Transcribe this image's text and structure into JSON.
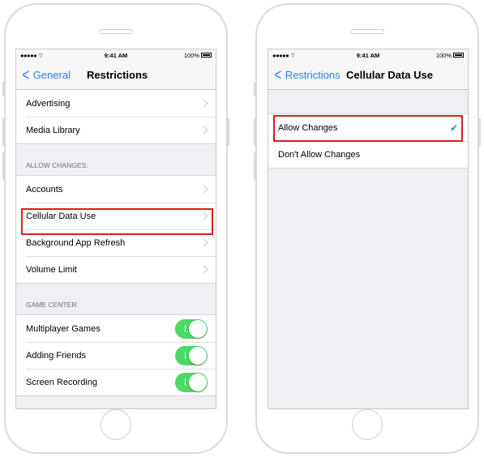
{
  "status_bar": {
    "signal": "●●●●● ⌔",
    "time": "9:41 AM",
    "battery": "100%"
  },
  "left_screen": {
    "back_label": "General",
    "title": "Restrictions",
    "top_items": [
      {
        "label": "Advertising"
      },
      {
        "label": "Media Library"
      }
    ],
    "allow_changes_header": "ALLOW CHANGES:",
    "allow_items": [
      {
        "label": "Accounts"
      },
      {
        "label": "Cellular Data Use"
      },
      {
        "label": "Background App Refresh"
      },
      {
        "label": "Volume Limit"
      }
    ],
    "game_center_header": "GAME CENTER:",
    "game_items": [
      {
        "label": "Multiplayer Games",
        "on": true
      },
      {
        "label": "Adding Friends",
        "on": true
      },
      {
        "label": "Screen Recording",
        "on": true
      }
    ]
  },
  "right_screen": {
    "back_label": "Restrictions",
    "title": "Cellular Data Use",
    "options": [
      {
        "label": "Allow Changes",
        "selected": true
      },
      {
        "label": "Don't Allow Changes",
        "selected": false
      }
    ],
    "checkmark": "✔"
  },
  "colors": {
    "accent": "#2e7cf6",
    "toggle_on": "#4cd964",
    "highlight": "#d91e1e"
  }
}
